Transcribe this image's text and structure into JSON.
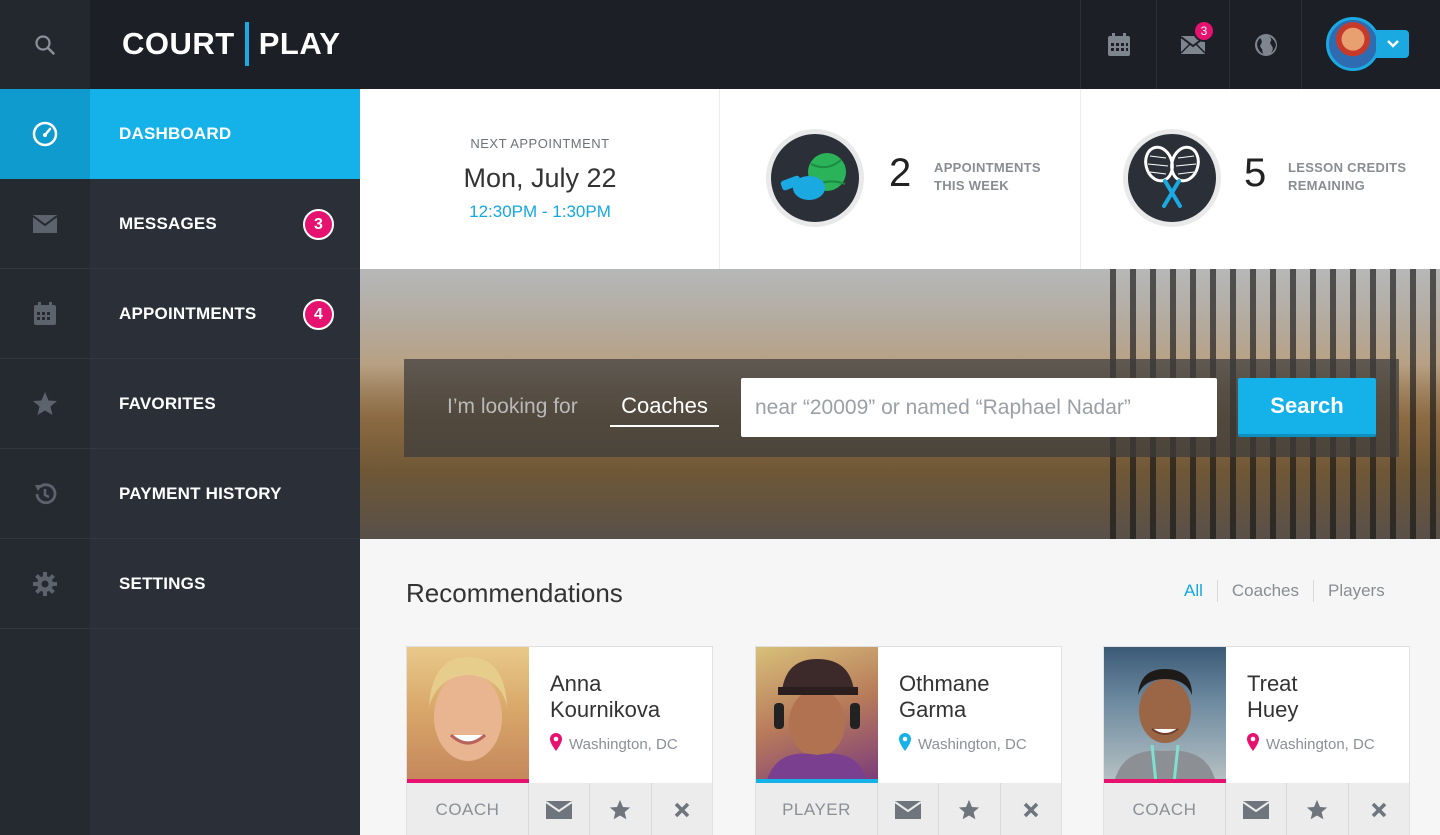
{
  "app": {
    "logo_left": "COURT",
    "logo_right": "PLAY"
  },
  "topbar": {
    "icons": [
      "search-icon",
      "calendar-icon",
      "mail-icon",
      "globe-icon",
      "chevron-down-icon"
    ],
    "mail_badge": "3"
  },
  "sidebar": {
    "items": [
      {
        "label": "DASHBOARD",
        "icon": "dashboard-icon",
        "active": true
      },
      {
        "label": "MESSAGES",
        "icon": "mail-icon",
        "count": "3"
      },
      {
        "label": "APPOINTMENTS",
        "icon": "calendar-icon",
        "count": "4"
      },
      {
        "label": "FAVORITES",
        "icon": "star-icon"
      },
      {
        "label": "PAYMENT HISTORY",
        "icon": "history-icon"
      },
      {
        "label": "SETTINGS",
        "icon": "gear-icon"
      }
    ]
  },
  "stats": {
    "next_label": "NEXT APPOINTMENT",
    "next_date": "Mon, July 22",
    "next_time": "12:30PM - 1:30PM",
    "appointments_num": "2",
    "appointments_line1": "APPOINTMENTS",
    "appointments_line2": "THIS WEEK",
    "credits_num": "5",
    "credits_line1": "LESSON CREDITS",
    "credits_line2": "REMAINING"
  },
  "search": {
    "prefix": "I’m looking for",
    "category": "Coaches",
    "placeholder": "near “20009” or named “Raphael Nadar”",
    "button": "Search"
  },
  "recommendations": {
    "title": "Recommendations",
    "filters": [
      "All",
      "Coaches",
      "Players"
    ],
    "cards": [
      {
        "first": "Anna",
        "last": "Kournikova",
        "location": "Washington, DC",
        "role": "COACH",
        "accent": "#e6126f"
      },
      {
        "first": "Othmane",
        "last": "Garma",
        "location": "Washington, DC",
        "role": "PLAYER",
        "accent": "#14b2e9"
      },
      {
        "first": "Treat",
        "last": "Huey",
        "location": "Washington, DC",
        "role": "COACH",
        "accent": "#e6126f"
      }
    ]
  },
  "colors": {
    "accent": "#14b2e9",
    "badge": "#e6126f",
    "sidebar": "#2b3038",
    "topbar": "#1c2026"
  }
}
